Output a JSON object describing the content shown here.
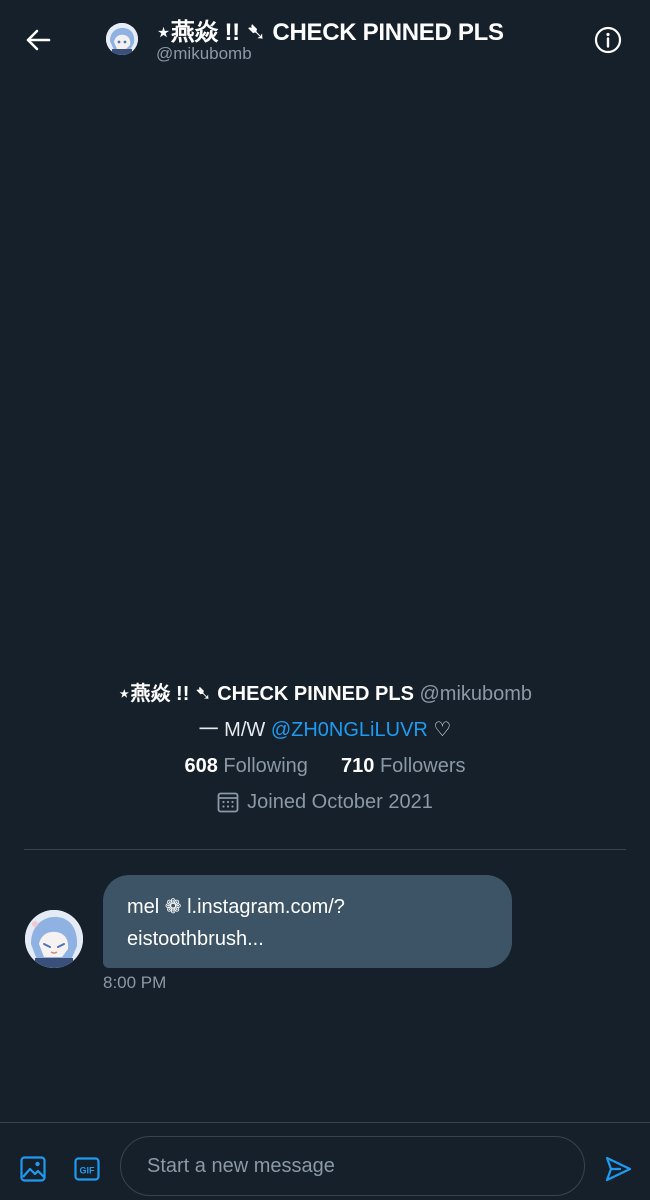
{
  "header": {
    "display_name": "⋆燕焱 !! ➷ CHECK PINNED PLS",
    "handle": "@mikubomb",
    "back_icon": "arrow-left-icon",
    "info_icon": "info-circle-icon"
  },
  "profile": {
    "display_name": "⋆燕焱 !! ➷ CHECK PINNED PLS",
    "handle": "@mikubomb",
    "bio_prefix": "一 M/W ",
    "bio_link": "@ZH0NGLiLUVR",
    "bio_suffix": " ♡",
    "following_count": "608",
    "following_label": "Following",
    "followers_count": "710",
    "followers_label": "Followers",
    "joined_icon": "calendar-icon",
    "joined_text": "Joined October 2021"
  },
  "messages": [
    {
      "text_line1": "mel ❁ l.instagram.com/?",
      "text_line2": "eistoothbrush...",
      "time": "8:00 PM"
    }
  ],
  "composer": {
    "placeholder": "Start a new message",
    "media_icon": "image-icon",
    "gif_icon": "gif-icon",
    "gif_label": "GIF",
    "send_icon": "send-icon"
  },
  "colors": {
    "background": "#15202b",
    "accent": "#1d9bf0",
    "bubble": "#3d5466",
    "muted_text": "#8b98a5",
    "divider": "#38444d"
  }
}
